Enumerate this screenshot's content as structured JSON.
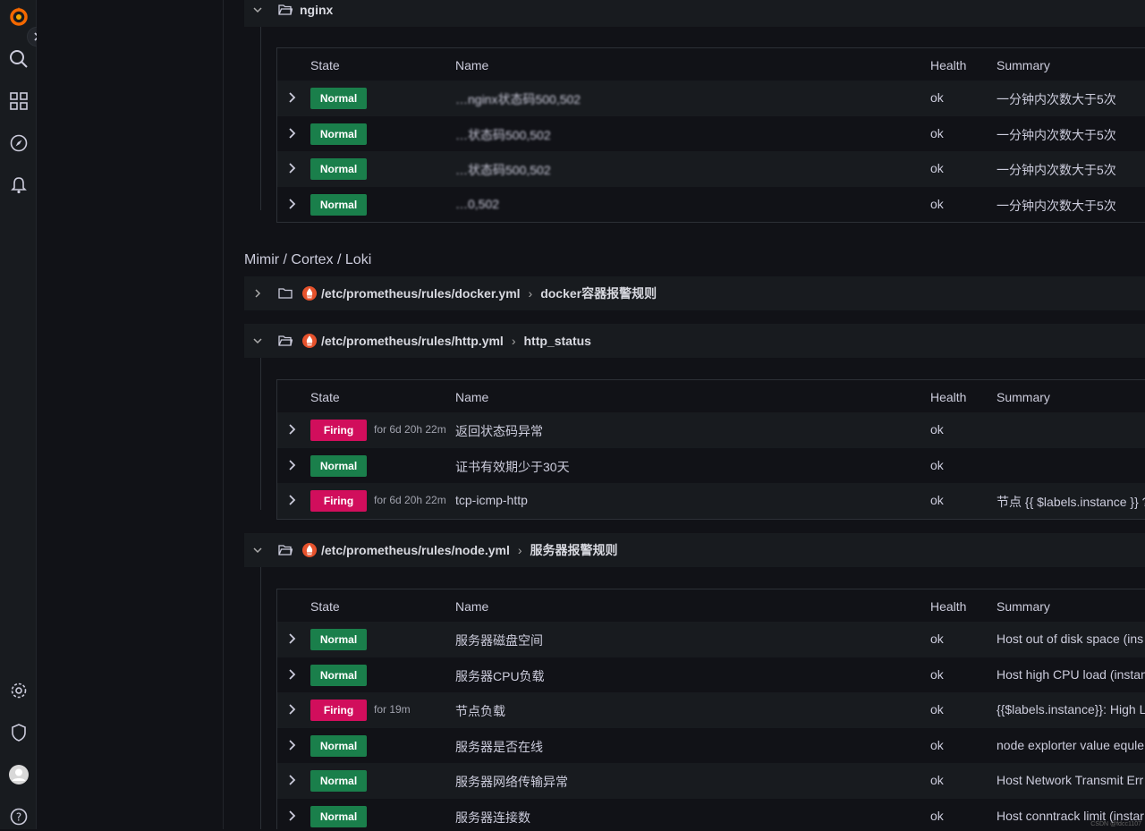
{
  "nav": {
    "toggle": "›"
  },
  "nginx_group": {
    "title": "nginx",
    "headers": {
      "state": "State",
      "name": "Name",
      "health": "Health",
      "summary": "Summary"
    },
    "rows": [
      {
        "state": "Normal",
        "name": "…nginx状态码500,502",
        "health": "ok",
        "summary": "一分钟内次数大于5次"
      },
      {
        "state": "Normal",
        "name": "…状态码500,502",
        "health": "ok",
        "summary": "一分钟内次数大于5次"
      },
      {
        "state": "Normal",
        "name": "…状态码500,502",
        "health": "ok",
        "summary": "一分钟内次数大于5次"
      },
      {
        "state": "Normal",
        "name": "…0,502",
        "health": "ok",
        "summary": "一分钟内次数大于5次"
      }
    ]
  },
  "section_title": "Mimir / Cortex / Loki",
  "docker_group": {
    "path": "/etc/prometheus/rules/docker.yml",
    "sep": "›",
    "name": "docker容器报警规则"
  },
  "http_group": {
    "path": "/etc/prometheus/rules/http.yml",
    "sep": "›",
    "name": "http_status",
    "headers": {
      "state": "State",
      "name": "Name",
      "health": "Health",
      "summary": "Summary"
    },
    "rows": [
      {
        "state": "Firing",
        "duration": "for 6d 20h 22m",
        "name": "返回状态码异常",
        "health": "ok",
        "summary": ""
      },
      {
        "state": "Normal",
        "duration": "",
        "name": "证书有效期少于30天",
        "health": "ok",
        "summary": ""
      },
      {
        "state": "Firing",
        "duration": "for 6d 20h 22m",
        "name": "tcp-icmp-http",
        "health": "ok",
        "summary": "节点 {{ $labels.instance }} ?"
      }
    ]
  },
  "node_group": {
    "path": "/etc/prometheus/rules/node.yml",
    "sep": "›",
    "name": "服务器报警规则",
    "headers": {
      "state": "State",
      "name": "Name",
      "health": "Health",
      "summary": "Summary"
    },
    "rows": [
      {
        "state": "Normal",
        "duration": "",
        "name": "服务器磁盘空间",
        "health": "ok",
        "summary": "Host out of disk space (ins"
      },
      {
        "state": "Normal",
        "duration": "",
        "name": "服务器CPU负载",
        "health": "ok",
        "summary": "Host high CPU load (instan"
      },
      {
        "state": "Firing",
        "duration": "for 19m",
        "name": "节点负载",
        "health": "ok",
        "summary": "{{$labels.instance}}: High L"
      },
      {
        "state": "Normal",
        "duration": "",
        "name": "服务器是否在线",
        "health": "ok",
        "summary": "node explorter value equle"
      },
      {
        "state": "Normal",
        "duration": "",
        "name": "服务器网络传输异常",
        "health": "ok",
        "summary": "Host Network Transmit Err"
      },
      {
        "state": "Normal",
        "duration": "",
        "name": "服务器连接数",
        "health": "ok",
        "summary": "Host conntrack limit (instar"
      }
    ]
  },
  "watermark": "CSDN @fdcc1107",
  "colors": {
    "normal": "#1a7f4b",
    "firing": "#d10e5c",
    "bg": "#111217",
    "panel": "#181b1f"
  }
}
